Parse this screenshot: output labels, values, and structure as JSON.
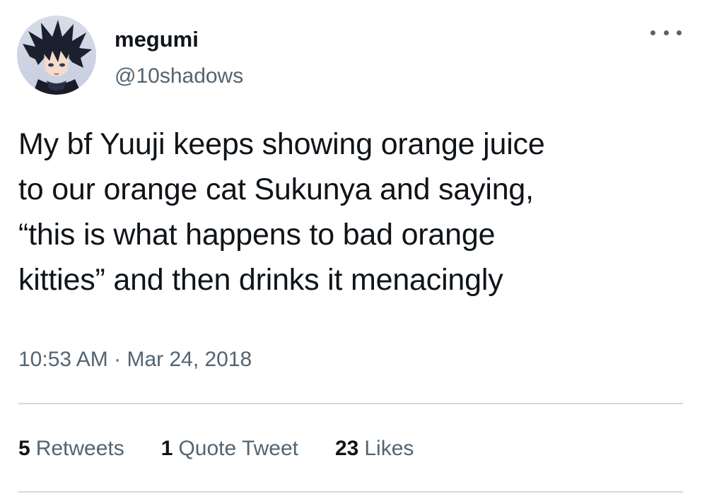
{
  "author": {
    "display_name": "megumi",
    "handle": "@10shadows",
    "avatar_icon": "anime-character-avatar"
  },
  "tweet": {
    "text": "My bf Yuuji keeps showing orange juice\nto our orange cat Sukunya and saying,\n“this is what happens to bad orange\nkitties” and then drinks it menacingly",
    "time": "10:53 AM",
    "separator": "·",
    "date": "Mar 24, 2018"
  },
  "stats": {
    "retweets_count": "5",
    "retweets_label": "Retweets",
    "quotes_count": "1",
    "quotes_label": "Quote Tweet",
    "likes_count": "23",
    "likes_label": "Likes"
  },
  "colors": {
    "text_primary": "#0f1419",
    "text_secondary": "#536471",
    "divider": "#cfd9de",
    "background": "#ffffff"
  },
  "icons": {
    "more": "more-horizontal-icon"
  }
}
